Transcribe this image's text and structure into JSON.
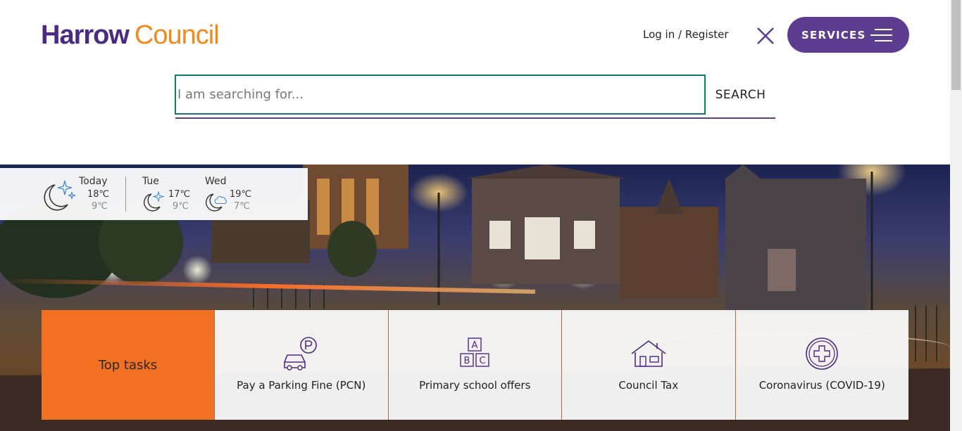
{
  "header": {
    "logo_part1": "Harrow",
    "logo_part2": "Council",
    "login_label": "Log in / Register",
    "services_label": "SERVICES"
  },
  "search": {
    "placeholder": "I am searching for...",
    "button_label": "SEARCH"
  },
  "weather": {
    "days": [
      {
        "name": "Today",
        "high": "18℃",
        "low": "9℃",
        "icon": "moon-stars-icon"
      },
      {
        "name": "Tue",
        "high": "17℃",
        "low": "9℃",
        "icon": "moon-stars-icon"
      },
      {
        "name": "Wed",
        "high": "19℃",
        "low": "7℃",
        "icon": "moon-cloud-icon"
      }
    ]
  },
  "top_tasks": {
    "heading": "Top tasks",
    "items": [
      {
        "label": "Pay a Parking Fine (PCN)",
        "icon": "parking-car-icon"
      },
      {
        "label": "Primary school offers",
        "icon": "abc-blocks-icon"
      },
      {
        "label": "Council Tax",
        "icon": "house-icon"
      },
      {
        "label": "Coronavirus (COVID-19)",
        "icon": "medical-cross-icon"
      }
    ]
  },
  "colors": {
    "brand_purple": "#4b2a82",
    "brand_orange": "#f08a1c",
    "services_bg": "#5c3d8f",
    "search_border": "#157a6e",
    "tasks_orange": "#f27021"
  }
}
